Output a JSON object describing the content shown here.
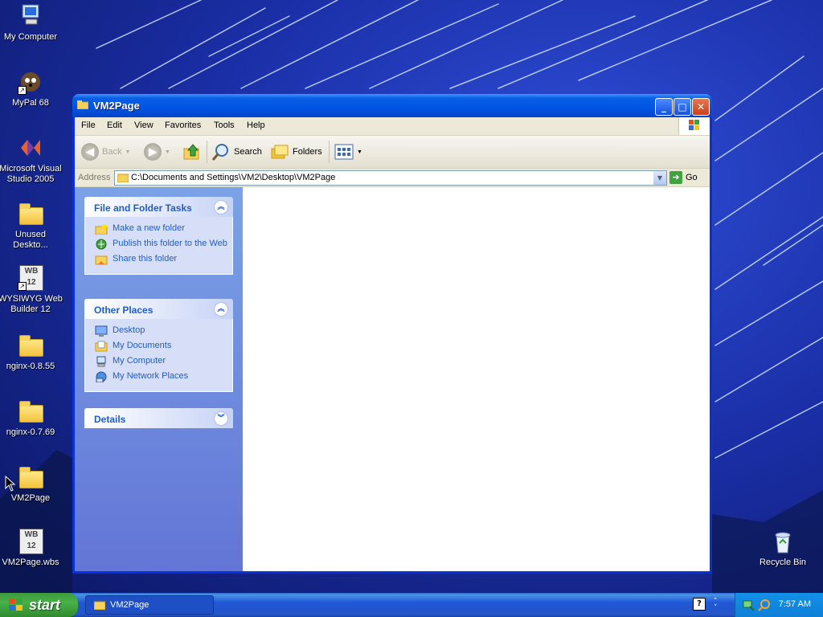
{
  "desktop": {
    "icons": [
      {
        "label": "My Computer",
        "icon": "computer-icon"
      },
      {
        "label": "MyPal 68",
        "icon": "mypal-icon"
      },
      {
        "label": "Microsoft Visual Studio 2005",
        "icon": "visual-studio-icon"
      },
      {
        "label": "Unused Deskto...",
        "icon": "folder-icon"
      },
      {
        "label": "WYSIWYG Web Builder 12",
        "icon": "web-builder-icon",
        "badge": "WB 12"
      },
      {
        "label": "nginx-0.8.55",
        "icon": "folder-icon"
      },
      {
        "label": "nginx-0.7.69",
        "icon": "folder-icon"
      },
      {
        "label": "VM2Page",
        "icon": "folder-icon"
      },
      {
        "label": "VM2Page.wbs",
        "icon": "web-builder-icon",
        "badge": "WB 12"
      },
      {
        "label": "Recycle Bin",
        "icon": "recycle-bin-icon"
      }
    ]
  },
  "window": {
    "title": "VM2Page",
    "menu": [
      "File",
      "Edit",
      "View",
      "Favorites",
      "Tools",
      "Help"
    ],
    "toolbar": {
      "back": "Back",
      "search": "Search",
      "folders": "Folders"
    },
    "address": {
      "label": "Address",
      "value": "C:\\Documents and Settings\\VM2\\Desktop\\VM2Page",
      "go": "Go"
    },
    "panels": {
      "tasks": {
        "title": "File and Folder Tasks",
        "items": [
          "Make a new folder",
          "Publish this folder to the Web",
          "Share this folder"
        ]
      },
      "places": {
        "title": "Other Places",
        "items": [
          "Desktop",
          "My Documents",
          "My Computer",
          "My Network Places"
        ]
      },
      "details": {
        "title": "Details"
      }
    }
  },
  "taskbar": {
    "start": "start",
    "task": "VM2Page",
    "clock": "7:57 AM"
  }
}
